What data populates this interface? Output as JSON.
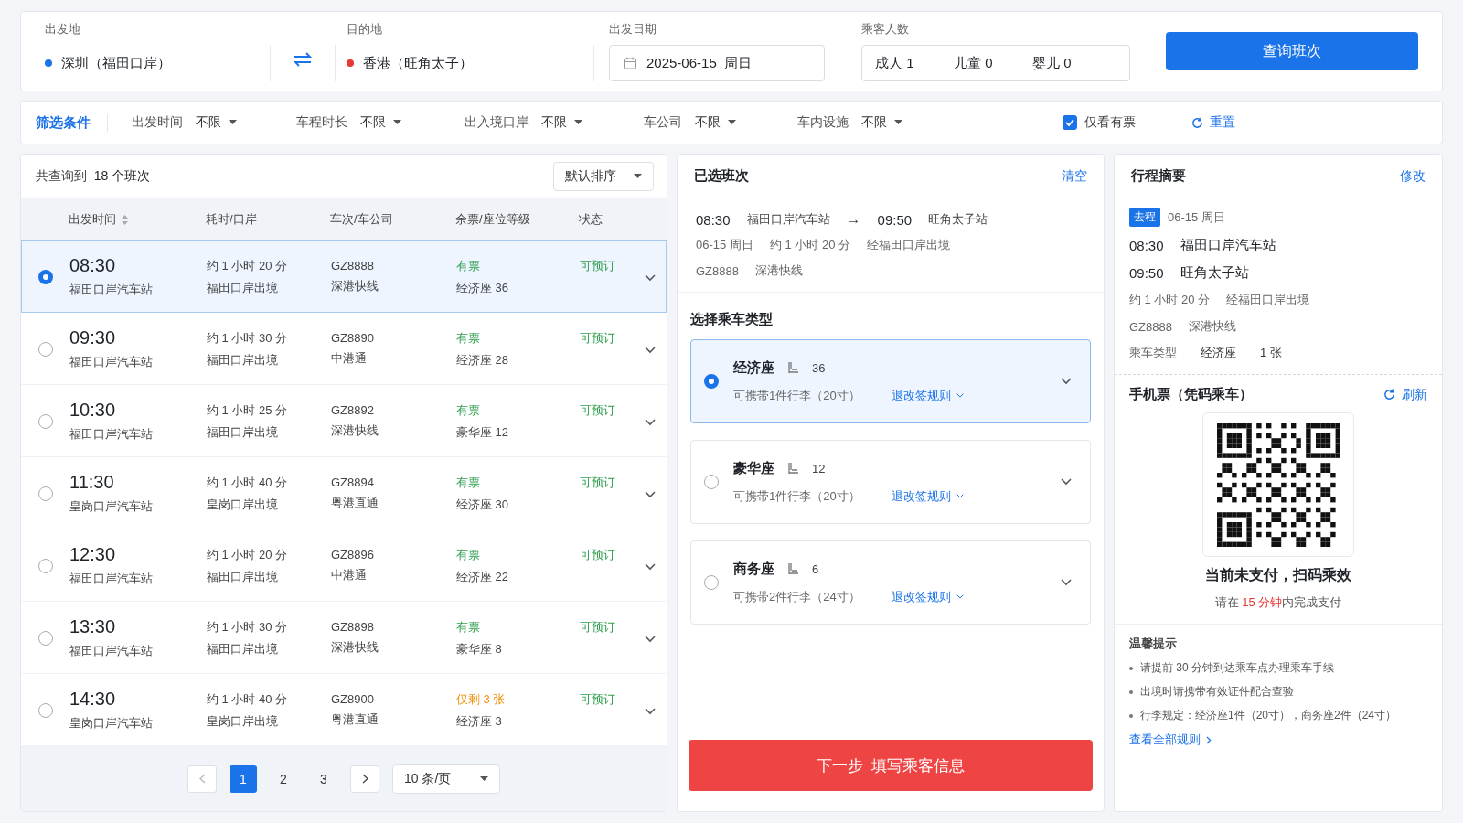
{
  "search": {
    "origin": {
      "label": "出发地",
      "value": "深圳（福田口岸）"
    },
    "destination": {
      "label": "目的地",
      "value": "香港（旺角太子）"
    },
    "date": {
      "label": "出发日期",
      "value": "2025-06-15  周日"
    },
    "passengers": {
      "label": "乘客人数",
      "items": [
        "成人 1",
        "儿童 0",
        "婴儿 0"
      ]
    },
    "submit": "查询班次"
  },
  "filters": {
    "title": "筛选条件",
    "items": [
      {
        "label": "出发时间",
        "value": "不限"
      },
      {
        "label": "车程时长",
        "value": "不限"
      },
      {
        "label": "出入境口岸",
        "value": "不限"
      },
      {
        "label": "车公司",
        "value": "不限"
      },
      {
        "label": "车内设施",
        "value": "不限"
      }
    ],
    "only_available": {
      "label": "仅看有票",
      "checked": true
    },
    "reset": "重置"
  },
  "results": {
    "count_prefix": "共查询到",
    "count": "18 个班次",
    "sort": "默认排序",
    "columns": [
      "出发时间",
      "耗时/口岸",
      "车次/车公司",
      "余票/座位等级",
      "状态"
    ],
    "rows": [
      {
        "selected": true,
        "time": "08:30",
        "station": "福田口岸汽车站",
        "duration": "约 1 小时 20 分",
        "port": "福田口岸出境",
        "code": "GZ8888",
        "company": "深港快线",
        "availability": "有票",
        "kind": "ample",
        "seat": "经济座 36",
        "status": "可预订"
      },
      {
        "selected": false,
        "time": "09:30",
        "station": "福田口岸汽车站",
        "duration": "约 1 小时 30 分",
        "port": "福田口岸出境",
        "code": "GZ8890",
        "company": "中港通",
        "availability": "有票",
        "kind": "ample",
        "seat": "经济座 28",
        "status": "可预订"
      },
      {
        "selected": false,
        "time": "10:30",
        "station": "福田口岸汽车站",
        "duration": "约 1 小时 25 分",
        "port": "福田口岸出境",
        "code": "GZ8892",
        "company": "深港快线",
        "availability": "有票",
        "kind": "ample",
        "seat": "豪华座 12",
        "status": "可预订"
      },
      {
        "selected": false,
        "time": "11:30",
        "station": "皇岗口岸汽车站",
        "duration": "约 1 小时 40 分",
        "port": "皇岗口岸出境",
        "code": "GZ8894",
        "company": "粤港直通",
        "availability": "有票",
        "kind": "ample",
        "seat": "经济座 30",
        "status": "可预订"
      },
      {
        "selected": false,
        "time": "12:30",
        "station": "福田口岸汽车站",
        "duration": "约 1 小时 20 分",
        "port": "福田口岸出境",
        "code": "GZ8896",
        "company": "中港通",
        "availability": "有票",
        "kind": "ample",
        "seat": "经济座 22",
        "status": "可预订"
      },
      {
        "selected": false,
        "time": "13:30",
        "station": "福田口岸汽车站",
        "duration": "约 1 小时 30 分",
        "port": "福田口岸出境",
        "code": "GZ8898",
        "company": "深港快线",
        "availability": "有票",
        "kind": "ample",
        "seat": "豪华座 8",
        "status": "可预订"
      },
      {
        "selected": false,
        "time": "14:30",
        "station": "皇岗口岸汽车站",
        "duration": "约 1 小时 40 分",
        "port": "皇岗口岸出境",
        "code": "GZ8900",
        "company": "粤港直通",
        "availability": "仅剩 3 张",
        "kind": "few",
        "seat": "经济座 3",
        "status": "可预订"
      }
    ],
    "pages": [
      {
        "label": "1",
        "selected": true
      },
      {
        "label": "2",
        "selected": false
      },
      {
        "label": "3",
        "selected": false
      }
    ],
    "page_size": "10 条/页"
  },
  "selected_trip": {
    "title": "已选班次",
    "clear": "清空",
    "depart_time": "08:30",
    "depart_station": "福田口岸汽车站",
    "arrow": "→",
    "arrive_time": "09:50",
    "arrive_station": "旺角太子站",
    "details": [
      "06-15 周日",
      "约 1 小时 20 分",
      "经福田口岸出境"
    ],
    "bus": [
      "GZ8888",
      "深港快线"
    ],
    "seat_title": "选择乘车类型",
    "seat_options": [
      {
        "name": "经济座",
        "seats": "36",
        "luggage": "可携带1件行李（20寸）",
        "rules": "退改签规则",
        "selected": true
      },
      {
        "name": "豪华座",
        "seats": "12",
        "luggage": "可携带1件行李（20寸）",
        "rules": "退改签规则",
        "selected": false
      },
      {
        "name": "商务座",
        "seats": "6",
        "luggage": "可携带2件行李（24寸）",
        "rules": "退改签规则",
        "selected": false
      }
    ],
    "next": "下一步  填写乘客信息"
  },
  "summary": {
    "title": "行程摘要",
    "edit": "修改",
    "tag": "去程",
    "date": "06-15 周日",
    "depart_time": "08:30",
    "depart_station": "福田口岸汽车站",
    "arrive_time": "09:50",
    "arrive_station": "旺角太子站",
    "details": [
      "约 1 小时 20 分",
      "经福田口岸出境"
    ],
    "bus": [
      "GZ8888",
      "深港快线"
    ],
    "ticket": [
      "乘车类型",
      "经济座",
      "1 张"
    ],
    "mobile_title": "手机票（凭码乘车）",
    "refresh": "刷新",
    "qr_caption": "当前未支付，扫码乘效",
    "pay_before": "请在 ",
    "pay_highlight": "15 分钟",
    "pay_after": "内完成支付",
    "tips_title": "温馨提示",
    "tips": [
      "请提前 30 分钟到达乘车点办理乘车手续",
      "出境时请携带有效证件配合查验",
      "行李规定：经济座1件（20寸），商务座2件（24寸）"
    ],
    "rules_link": "查看全部规则"
  }
}
